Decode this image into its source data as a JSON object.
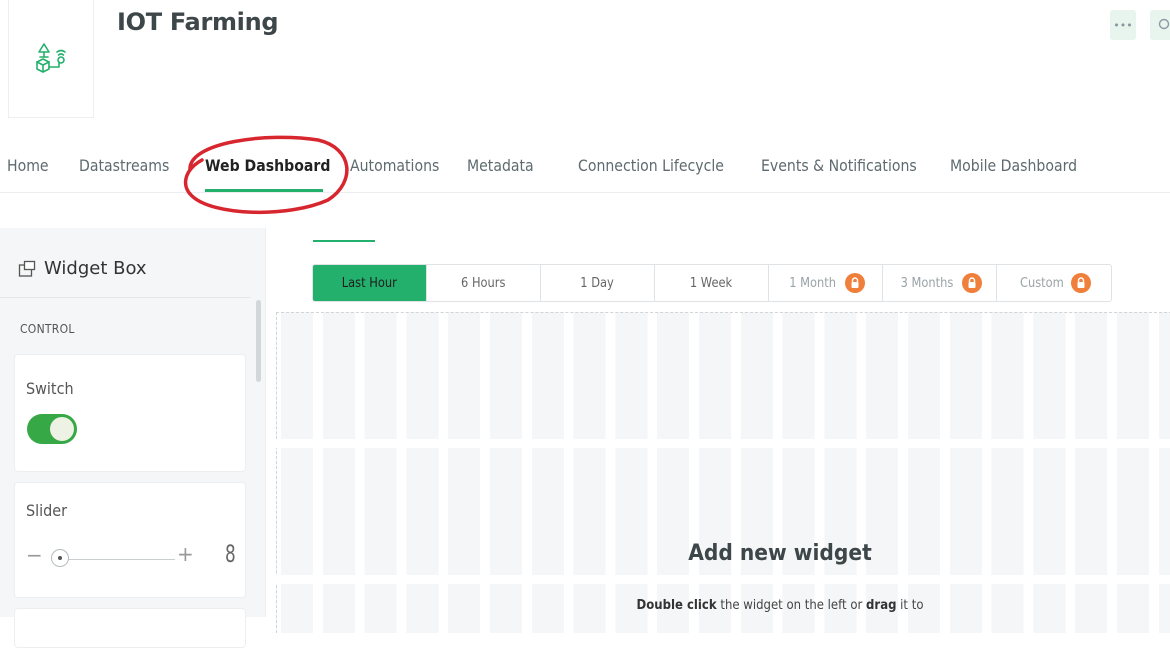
{
  "header": {
    "title": "IOT Farming",
    "logo_icon": "device-template-icon",
    "more_button_label": "•••"
  },
  "nav": {
    "tabs": [
      {
        "label": "Home"
      },
      {
        "label": "Datastreams"
      },
      {
        "label": "Web Dashboard",
        "active": true
      },
      {
        "label": "Automations"
      },
      {
        "label": "Metadata"
      },
      {
        "label": "Connection Lifecycle"
      },
      {
        "label": "Events & Notifications"
      },
      {
        "label": "Mobile Dashboard"
      }
    ],
    "accent_color": "#23b06c",
    "annotation_color": "#d7262e"
  },
  "widget_box": {
    "title": "Widget Box",
    "section_label": "CONTROL",
    "switch_card": {
      "title": "Switch",
      "state": "on"
    },
    "slider_card": {
      "title": "Slider",
      "minus": "−",
      "plus": "+",
      "value": "8",
      "level": 0.05
    }
  },
  "time_range": {
    "buttons": [
      {
        "label": "Last Hour",
        "active": true,
        "locked": false
      },
      {
        "label": "6 Hours",
        "active": false,
        "locked": false
      },
      {
        "label": "1 Day",
        "active": false,
        "locked": false
      },
      {
        "label": "1 Week",
        "active": false,
        "locked": false
      },
      {
        "label": "1 Month",
        "active": false,
        "locked": true
      },
      {
        "label": "3 Months",
        "active": false,
        "locked": true
      },
      {
        "label": "Custom",
        "active": false,
        "locked": true
      }
    ],
    "lock_color": "#ef7f3b"
  },
  "canvas": {
    "empty_title": "Add new widget",
    "hint_bold_1": "Double click",
    "hint_text_1": " the widget on the left or ",
    "hint_bold_2": "drag",
    "hint_text_2": " it to"
  }
}
